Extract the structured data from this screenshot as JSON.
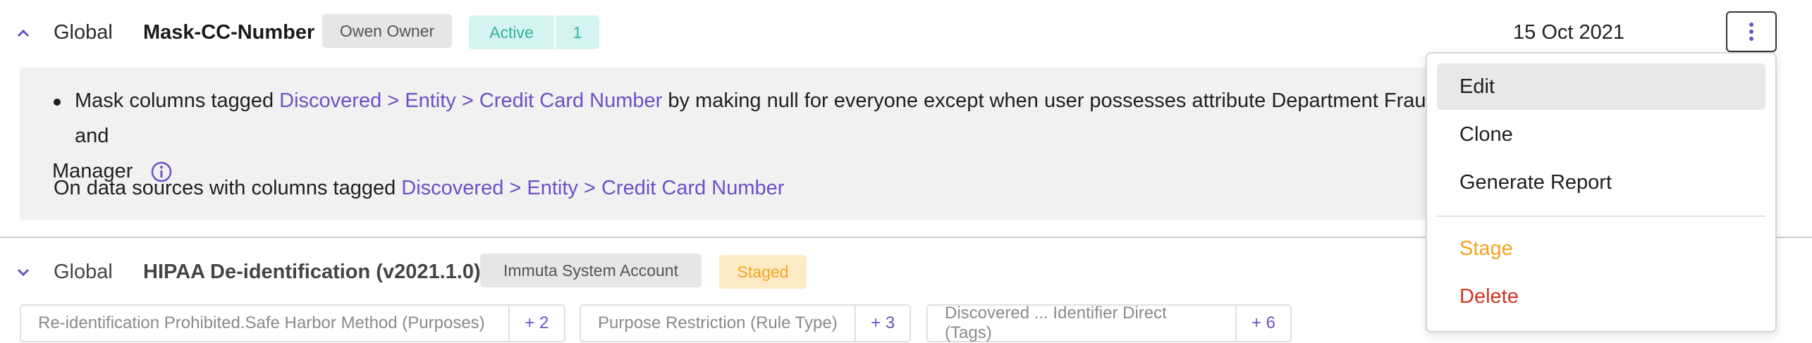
{
  "policy1": {
    "scope": "Global",
    "name": "Mask-CC-Number",
    "owner": "Owen Owner",
    "status_label": "Active",
    "status_count": "1",
    "date": "15 Oct 2021",
    "description": {
      "prefix": "Mask columns tagged ",
      "tag_link": "Discovered > Entity > Credit Card Number",
      "middle": " by making null for everyone except when user possesses attribute Department Fraud and",
      "line2": "Manager"
    },
    "data_sources": {
      "prefix": "On data sources with columns tagged ",
      "tag_link": "Discovered > Entity > Credit Card Number"
    }
  },
  "policy2": {
    "scope": "Global",
    "name": "HIPAA De-identification (v2021.1.0)",
    "account": "Immuta System Account",
    "status_label": "Staged",
    "tags": [
      {
        "label": "Re-identification Prohibited.Safe Harbor Method (Purposes)",
        "count": "+ 2"
      },
      {
        "label": "Purpose Restriction (Rule Type)",
        "count": "+ 3"
      },
      {
        "label": "Discovered ... Identifier Direct (Tags)",
        "count": "+ 6"
      }
    ]
  },
  "menu": {
    "items": [
      {
        "label": "Edit",
        "color": "#1f1f1f"
      },
      {
        "label": "Clone",
        "color": "#1f1f1f"
      },
      {
        "label": "Generate Report",
        "color": "#1f1f1f"
      },
      {
        "label": "Stage",
        "color": "#f2a51e"
      },
      {
        "label": "Delete",
        "color": "#d2321e"
      }
    ]
  },
  "colors": {
    "accent": "#6e4fc8",
    "active": "#2eb59a",
    "staged": "#f2a51e",
    "delete": "#d2321e"
  },
  "icons": {
    "expand_open": "chevron-up-icon",
    "expand_closed": "chevron-down-icon",
    "more": "kebab-menu-icon",
    "info": "info-icon"
  }
}
